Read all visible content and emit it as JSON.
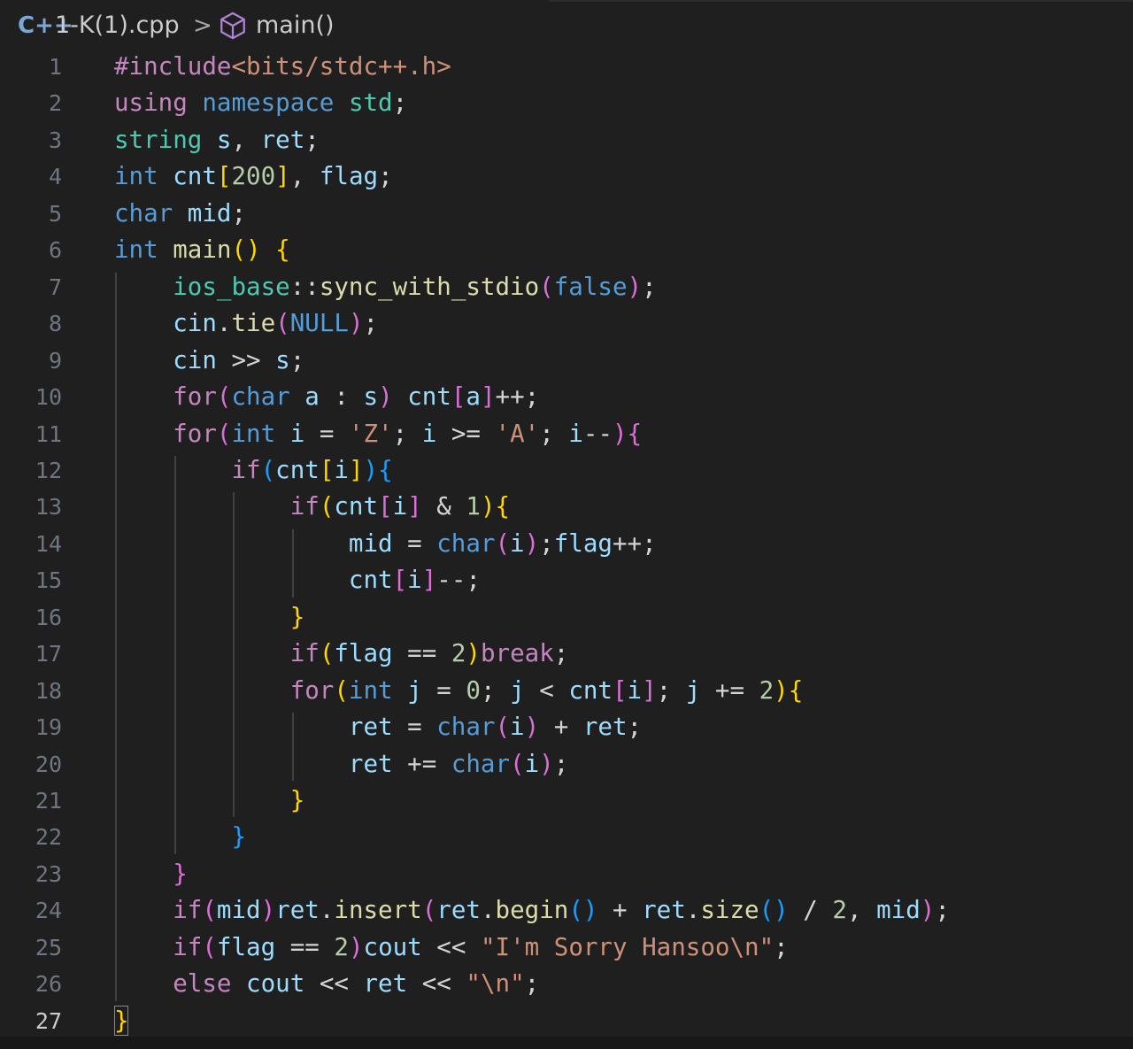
{
  "breadcrumb": {
    "file_icon": "C++",
    "file_name": "1-K(1).cpp",
    "separator": ">",
    "symbol_icon": "cube-icon",
    "symbol_name": "main()"
  },
  "editor": {
    "active_line": 27,
    "colors": {
      "keyword_purple": "#c586c0",
      "keyword_blue": "#569cd6",
      "type_teal": "#4ec9b0",
      "variable": "#9cdcfe",
      "function": "#dcdcaa",
      "string": "#ce9178",
      "number": "#b5cea8",
      "bracket_gold": "#ffd700",
      "bracket_pink": "#da70d6",
      "bracket_blue": "#179fff",
      "punctuation": "#d4d4d4",
      "line_number": "#6e7681",
      "background": "#1f1f1f"
    },
    "lines": [
      {
        "n": 1,
        "tokens": [
          [
            "#include",
            "inc"
          ],
          [
            "<bits/stdc++.h>",
            "str"
          ]
        ]
      },
      {
        "n": 2,
        "tokens": [
          [
            "using",
            "kwp"
          ],
          [
            " ",
            "p"
          ],
          [
            "namespace",
            "kwb"
          ],
          [
            " ",
            "p"
          ],
          [
            "std",
            "typ"
          ],
          [
            ";",
            "p"
          ]
        ]
      },
      {
        "n": 3,
        "tokens": [
          [
            "string",
            "typ"
          ],
          [
            " ",
            "p"
          ],
          [
            "s",
            "var"
          ],
          [
            ", ",
            "p"
          ],
          [
            "ret",
            "var"
          ],
          [
            ";",
            "p"
          ]
        ]
      },
      {
        "n": 4,
        "tokens": [
          [
            "int",
            "kwb"
          ],
          [
            " ",
            "p"
          ],
          [
            "cnt",
            "var"
          ],
          [
            "[",
            "b1"
          ],
          [
            "200",
            "num"
          ],
          [
            "]",
            "b1"
          ],
          [
            ", ",
            "p"
          ],
          [
            "flag",
            "var"
          ],
          [
            ";",
            "p"
          ]
        ]
      },
      {
        "n": 5,
        "tokens": [
          [
            "char",
            "kwb"
          ],
          [
            " ",
            "p"
          ],
          [
            "mid",
            "var"
          ],
          [
            ";",
            "p"
          ]
        ]
      },
      {
        "n": 6,
        "tokens": [
          [
            "int",
            "kwb"
          ],
          [
            " ",
            "p"
          ],
          [
            "main",
            "fn"
          ],
          [
            "()",
            "b1"
          ],
          [
            " ",
            "p"
          ],
          [
            "{",
            "b1"
          ]
        ]
      },
      {
        "n": 7,
        "tokens": [
          [
            "    ",
            "p"
          ],
          [
            "ios_base",
            "typ"
          ],
          [
            "::",
            "p"
          ],
          [
            "sync_with_stdio",
            "fn"
          ],
          [
            "(",
            "b2"
          ],
          [
            "false",
            "kwb"
          ],
          [
            ")",
            "b2"
          ],
          [
            ";",
            "p"
          ]
        ]
      },
      {
        "n": 8,
        "tokens": [
          [
            "    ",
            "p"
          ],
          [
            "cin",
            "var"
          ],
          [
            ".",
            "p"
          ],
          [
            "tie",
            "fn"
          ],
          [
            "(",
            "b2"
          ],
          [
            "NULL",
            "kwb"
          ],
          [
            ")",
            "b2"
          ],
          [
            ";",
            "p"
          ]
        ]
      },
      {
        "n": 9,
        "tokens": [
          [
            "    ",
            "p"
          ],
          [
            "cin",
            "var"
          ],
          [
            " >> ",
            "p"
          ],
          [
            "s",
            "var"
          ],
          [
            ";",
            "p"
          ]
        ]
      },
      {
        "n": 10,
        "tokens": [
          [
            "    ",
            "p"
          ],
          [
            "for",
            "kwp"
          ],
          [
            "(",
            "b2"
          ],
          [
            "char",
            "kwb"
          ],
          [
            " ",
            "p"
          ],
          [
            "a",
            "var"
          ],
          [
            " : ",
            "p"
          ],
          [
            "s",
            "var"
          ],
          [
            ")",
            "b2"
          ],
          [
            " ",
            "p"
          ],
          [
            "cnt",
            "var"
          ],
          [
            "[",
            "b2"
          ],
          [
            "a",
            "var"
          ],
          [
            "]",
            "b2"
          ],
          [
            "++;",
            "p"
          ]
        ]
      },
      {
        "n": 11,
        "tokens": [
          [
            "    ",
            "p"
          ],
          [
            "for",
            "kwp"
          ],
          [
            "(",
            "b2"
          ],
          [
            "int",
            "kwb"
          ],
          [
            " ",
            "p"
          ],
          [
            "i",
            "var"
          ],
          [
            " = ",
            "p"
          ],
          [
            "'Z'",
            "str"
          ],
          [
            "; ",
            "p"
          ],
          [
            "i",
            "var"
          ],
          [
            " >= ",
            "p"
          ],
          [
            "'A'",
            "str"
          ],
          [
            "; ",
            "p"
          ],
          [
            "i",
            "var"
          ],
          [
            "--",
            "p"
          ],
          [
            ")",
            "b2"
          ],
          [
            "{",
            "b2"
          ]
        ]
      },
      {
        "n": 12,
        "tokens": [
          [
            "        ",
            "p"
          ],
          [
            "if",
            "kwp"
          ],
          [
            "(",
            "b3"
          ],
          [
            "cnt",
            "var"
          ],
          [
            "[",
            "b1"
          ],
          [
            "i",
            "var"
          ],
          [
            "]",
            "b1"
          ],
          [
            ")",
            "b3"
          ],
          [
            "{",
            "b3"
          ]
        ]
      },
      {
        "n": 13,
        "tokens": [
          [
            "            ",
            "p"
          ],
          [
            "if",
            "kwp"
          ],
          [
            "(",
            "b1"
          ],
          [
            "cnt",
            "var"
          ],
          [
            "[",
            "b2"
          ],
          [
            "i",
            "var"
          ],
          [
            "]",
            "b2"
          ],
          [
            " & ",
            "p"
          ],
          [
            "1",
            "num"
          ],
          [
            ")",
            "b1"
          ],
          [
            "{",
            "b1"
          ]
        ]
      },
      {
        "n": 14,
        "tokens": [
          [
            "                ",
            "p"
          ],
          [
            "mid",
            "var"
          ],
          [
            " = ",
            "p"
          ],
          [
            "char",
            "kwb"
          ],
          [
            "(",
            "b2"
          ],
          [
            "i",
            "var"
          ],
          [
            ")",
            "b2"
          ],
          [
            ";",
            "p"
          ],
          [
            "flag",
            "var"
          ],
          [
            "++;",
            "p"
          ]
        ]
      },
      {
        "n": 15,
        "tokens": [
          [
            "                ",
            "p"
          ],
          [
            "cnt",
            "var"
          ],
          [
            "[",
            "b2"
          ],
          [
            "i",
            "var"
          ],
          [
            "]",
            "b2"
          ],
          [
            "--;",
            "p"
          ]
        ]
      },
      {
        "n": 16,
        "tokens": [
          [
            "            ",
            "p"
          ],
          [
            "}",
            "b1"
          ]
        ]
      },
      {
        "n": 17,
        "tokens": [
          [
            "            ",
            "p"
          ],
          [
            "if",
            "kwp"
          ],
          [
            "(",
            "b1"
          ],
          [
            "flag",
            "var"
          ],
          [
            " == ",
            "p"
          ],
          [
            "2",
            "num"
          ],
          [
            ")",
            "b1"
          ],
          [
            "break",
            "kwp"
          ],
          [
            ";",
            "p"
          ]
        ]
      },
      {
        "n": 18,
        "tokens": [
          [
            "            ",
            "p"
          ],
          [
            "for",
            "kwp"
          ],
          [
            "(",
            "b1"
          ],
          [
            "int",
            "kwb"
          ],
          [
            " ",
            "p"
          ],
          [
            "j",
            "var"
          ],
          [
            " = ",
            "p"
          ],
          [
            "0",
            "num"
          ],
          [
            "; ",
            "p"
          ],
          [
            "j",
            "var"
          ],
          [
            " < ",
            "p"
          ],
          [
            "cnt",
            "var"
          ],
          [
            "[",
            "b2"
          ],
          [
            "i",
            "var"
          ],
          [
            "]",
            "b2"
          ],
          [
            "; ",
            "p"
          ],
          [
            "j",
            "var"
          ],
          [
            " += ",
            "p"
          ],
          [
            "2",
            "num"
          ],
          [
            ")",
            "b1"
          ],
          [
            "{",
            "b1"
          ]
        ]
      },
      {
        "n": 19,
        "tokens": [
          [
            "                ",
            "p"
          ],
          [
            "ret",
            "var"
          ],
          [
            " = ",
            "p"
          ],
          [
            "char",
            "kwb"
          ],
          [
            "(",
            "b2"
          ],
          [
            "i",
            "var"
          ],
          [
            ")",
            "b2"
          ],
          [
            " + ",
            "p"
          ],
          [
            "ret",
            "var"
          ],
          [
            ";",
            "p"
          ]
        ]
      },
      {
        "n": 20,
        "tokens": [
          [
            "                ",
            "p"
          ],
          [
            "ret",
            "var"
          ],
          [
            " += ",
            "p"
          ],
          [
            "char",
            "kwb"
          ],
          [
            "(",
            "b2"
          ],
          [
            "i",
            "var"
          ],
          [
            ")",
            "b2"
          ],
          [
            ";",
            "p"
          ]
        ]
      },
      {
        "n": 21,
        "tokens": [
          [
            "            ",
            "p"
          ],
          [
            "}",
            "b1"
          ]
        ]
      },
      {
        "n": 22,
        "tokens": [
          [
            "        ",
            "p"
          ],
          [
            "}",
            "b3"
          ]
        ]
      },
      {
        "n": 23,
        "tokens": [
          [
            "    ",
            "p"
          ],
          [
            "}",
            "b2"
          ]
        ]
      },
      {
        "n": 24,
        "tokens": [
          [
            "    ",
            "p"
          ],
          [
            "if",
            "kwp"
          ],
          [
            "(",
            "b2"
          ],
          [
            "mid",
            "var"
          ],
          [
            ")",
            "b2"
          ],
          [
            "ret",
            "var"
          ],
          [
            ".",
            "p"
          ],
          [
            "insert",
            "fn"
          ],
          [
            "(",
            "b2"
          ],
          [
            "ret",
            "var"
          ],
          [
            ".",
            "p"
          ],
          [
            "begin",
            "fn"
          ],
          [
            "()",
            "b3"
          ],
          [
            " + ",
            "p"
          ],
          [
            "ret",
            "var"
          ],
          [
            ".",
            "p"
          ],
          [
            "size",
            "fn"
          ],
          [
            "()",
            "b3"
          ],
          [
            " / ",
            "p"
          ],
          [
            "2",
            "num"
          ],
          [
            ", ",
            "p"
          ],
          [
            "mid",
            "var"
          ],
          [
            ")",
            "b2"
          ],
          [
            ";",
            "p"
          ]
        ]
      },
      {
        "n": 25,
        "tokens": [
          [
            "    ",
            "p"
          ],
          [
            "if",
            "kwp"
          ],
          [
            "(",
            "b2"
          ],
          [
            "flag",
            "var"
          ],
          [
            " == ",
            "p"
          ],
          [
            "2",
            "num"
          ],
          [
            ")",
            "b2"
          ],
          [
            "cout",
            "var"
          ],
          [
            " << ",
            "p"
          ],
          [
            "\"I'm Sorry Hansoo",
            "str"
          ],
          [
            "\\n",
            "esc"
          ],
          [
            "\"",
            "str"
          ],
          [
            ";",
            "p"
          ]
        ]
      },
      {
        "n": 26,
        "tokens": [
          [
            "    ",
            "p"
          ],
          [
            "else",
            "kwp"
          ],
          [
            " ",
            "p"
          ],
          [
            "cout",
            "var"
          ],
          [
            " << ",
            "p"
          ],
          [
            "ret",
            "var"
          ],
          [
            " << ",
            "p"
          ],
          [
            "\"",
            "str"
          ],
          [
            "\\n",
            "esc"
          ],
          [
            "\"",
            "str"
          ],
          [
            ";",
            "p"
          ]
        ]
      },
      {
        "n": 27,
        "tokens": [
          [
            "}",
            "b1"
          ]
        ]
      }
    ]
  }
}
